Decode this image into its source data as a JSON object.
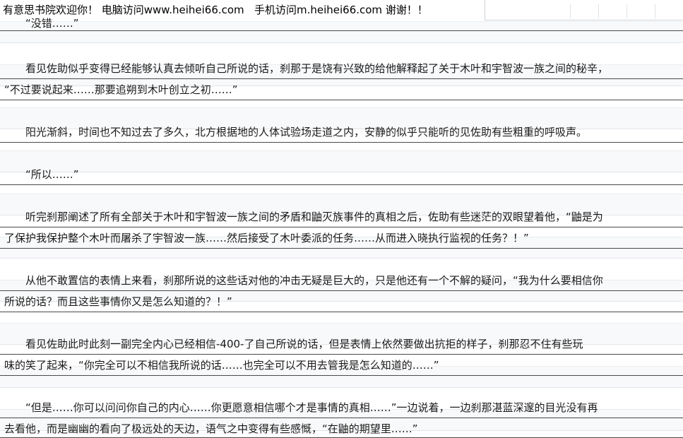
{
  "banner": {
    "text": "有意思书院欢迎你！ 电脑访问www.heihei66.com   手机访问m.heihei66.com 谢谢！！"
  },
  "lines": [
    "“没错……”",
    "看见佐助似乎变得已经能够认真去倾听自己所说的话，刹那于是饶有兴致的给他解释起了关于木叶和宇智波一族之间的秘辛，",
    "“不过要说起来……那要追朔到木叶创立之初……”",
    "阳光渐斜，时间也不知过去了多久，北方根据地的人体试验场走道之内，安静的似乎只能听的见佐助有些粗重的呼吸声。",
    "“所以……”",
    "听完刹那阐述了所有全部关于木叶和宇智波一族之间的矛盾和鼬灭族事件的真相之后，佐助有些迷茫的双眼望着他，“鼬是为",
    "了保护我保护整个木叶而屠杀了宇智波一族……然后接受了木叶委派的任务……从而进入晓执行监视的任务？！”",
    "从他不敢置信的表情上来看，刹那所说的这些话对他的冲击无疑是巨大的，只是他还有一个不解的疑问，“我为什么要相信你",
    "所说的话？而且这些事情你又是怎么知道的？！”",
    "看见佐助此时此刻一副完全内心已经相信-400-了自己所说的话，但是表情上依然要做出抗拒的样子，刹那忍不住有些玩",
    "味的笑了起来，“你完全可以不相信我所说的话……也完全可以不用去管我是怎么知道的……”",
    "“但是……你可以问问你自己的内心……你更愿意相信哪个才是事情的真相……”一边说着，一边刹那湛蓝深邃的目光没有再",
    "去看他，而是幽幽的看向了极远处的天边，语气之中变得有些感慨，“在鼬的期望里……”"
  ]
}
